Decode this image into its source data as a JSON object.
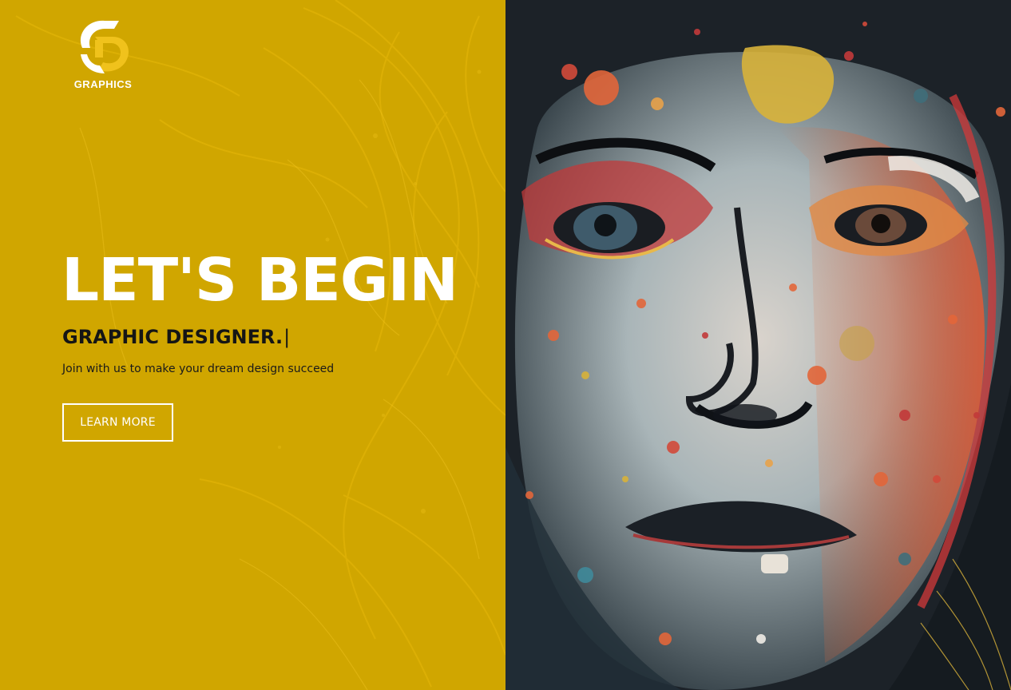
{
  "brand": {
    "logo_icon": "gd-monogram-icon",
    "name": "GRAPHICS",
    "primary_color": "#d0a600"
  },
  "hero": {
    "title": "LET'S BEGIN",
    "subtitle": "GRAPHIC DESIGNER.",
    "cursor": "|",
    "tagline": "Join with us to make your dream design succeed",
    "cta_label": "LEARN MORE"
  },
  "artwork": {
    "subject": "abstract-painted-face"
  }
}
